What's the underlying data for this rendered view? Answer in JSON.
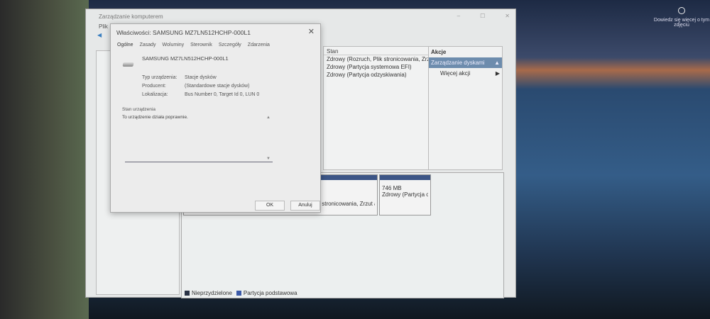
{
  "window": {
    "title": "Zarządzanie komputerem",
    "menu": "Plik"
  },
  "list": {
    "header": "Stan",
    "rows": [
      "Zdrowy (Rozruch, Plik stronicowania, Zrzut awa",
      "Zdrowy (Partycja systemowa EFI)",
      "Zdrowy (Partycja odzyskiwania)"
    ]
  },
  "actions": {
    "header": "Akcje",
    "selected": "Zarządzanie dyskami",
    "more": "Więcej akcji"
  },
  "disk": {
    "partition1_status": "s stronicowania, Zrzut a",
    "partition2_size": "746 MB",
    "partition2_status": "Zdrowy (Partycja odz"
  },
  "legend": [
    {
      "label": "Nieprzydzielone",
      "color": "#2a3346"
    },
    {
      "label": "Partycja podstawowa",
      "color": "#3b5aa8"
    }
  ],
  "dialog": {
    "title": "Właściwości: SAMSUNG MZ7LN512HCHP-000L1",
    "tabs": [
      "Ogólne",
      "Zasady",
      "Woluminy",
      "Sterownik",
      "Szczegóły",
      "Zdarzenia"
    ],
    "device_name": "SAMSUNG MZ7LN512HCHP-000L1",
    "fields": [
      {
        "label": "Typ urządzenia:",
        "value": "Stacje dysków"
      },
      {
        "label": "Producent:",
        "value": "(Standardowe stacje dysków)"
      },
      {
        "label": "Lokalizacja:",
        "value": "Bus Number 0, Target Id 0, LUN 0"
      }
    ],
    "status_label": "Stan urządzenia",
    "status_text": "To urządzenie działa poprawnie.",
    "ok": "OK",
    "cancel": "Anuluj"
  },
  "notice": "Dowiedz się więcej o tym zdjęciu"
}
